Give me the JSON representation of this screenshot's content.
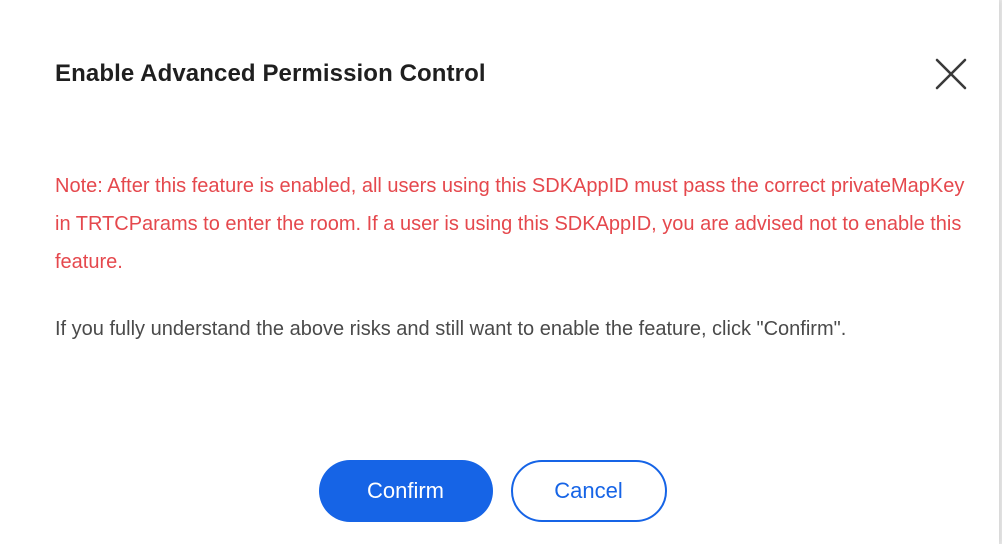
{
  "dialog": {
    "title": "Enable Advanced Permission Control",
    "note": "Note: After this feature is enabled, all users using this SDKAppID must pass the correct privateMapKey in TRTCParams to enter the room. If a user is using this SDKAppID, you are advised not to enable this feature.",
    "info": "If you fully understand the above risks and still want to enable the feature, click \"Confirm\".",
    "confirm_label": "Confirm",
    "cancel_label": "Cancel",
    "close_icon": "close-icon"
  },
  "colors": {
    "accent": "#1664e6",
    "warning": "#e5484d",
    "title": "#1f1f1f",
    "body": "#4a4a4a"
  }
}
